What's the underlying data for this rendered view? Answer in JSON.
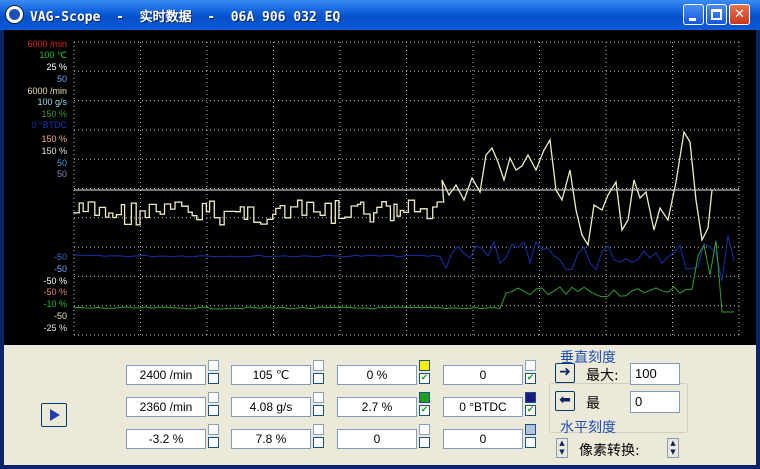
{
  "window": {
    "title": "VAG-Scope  -  实时数据  -  06A 906 032 EQ",
    "btn_minimize": "",
    "btn_maximize": "",
    "btn_close": ""
  },
  "scope": {
    "scale_labels": [
      {
        "text": "6000 /min",
        "color": "#E02020"
      },
      {
        "text": "100 ℃",
        "color": "#20C020"
      },
      {
        "text": "25 %",
        "color": "#FFFFFF"
      },
      {
        "text": "50",
        "color": "#6FA8FF"
      },
      {
        "text": "6000 /min",
        "color": "#E8E0B0"
      },
      {
        "text": "100 g/s",
        "color": "#9ED8E8"
      },
      {
        "text": "150 %",
        "color": "#3A9A3A"
      },
      {
        "text": "0 °BTDC",
        "color": "#1A2FB0"
      },
      {
        "text": "150 %",
        "color": "#F0B090"
      },
      {
        "text": "150 %",
        "color": "#E0E0E0"
      },
      {
        "text": "50",
        "color": "#4AA0E0"
      },
      {
        "text": "50",
        "color": "#8888C0"
      },
      {
        "text": "-50",
        "color": "#2070D0"
      },
      {
        "text": "-50",
        "color": "#6FA8FF"
      },
      {
        "text": "-50 %",
        "color": "#FFFFFF"
      },
      {
        "text": "-50 %",
        "color": "#E08080"
      },
      {
        "text": "-10 %",
        "color": "#20C020"
      },
      {
        "text": "-50",
        "color": "#E8E0B0"
      },
      {
        "text": "-25 %",
        "color": "#E0E0E0"
      }
    ],
    "series": [
      {
        "name": "",
        "color": "#EEEBC0"
      },
      {
        "name": "",
        "color": "#1830A8"
      },
      {
        "name": "",
        "color": "#30A030"
      }
    ]
  },
  "fields": {
    "r1c1": "2400 /min",
    "r1c2": "105 ℃",
    "r1c3": "0 %",
    "r1c4": "0",
    "r2c1": "2360 /min",
    "r2c2": "4.08 g/s",
    "r2c3": "2.7 %",
    "r2c4": "0 °BTDC",
    "r3c1": "-3.2 %",
    "r3c2": "7.8 %",
    "r3c3": "0",
    "r3c4": "0"
  },
  "swatch_colors": {
    "ch3": "#F8F000",
    "ch7": "#20A020",
    "ch11": "#1A1A80",
    "ch12": "#B0C4E0"
  },
  "vertical_scale": {
    "title": "垂直刻度",
    "max_label": "最大:",
    "max_value": "100",
    "min_label": "最",
    "min_value": "0",
    "right_arrow": "➜",
    "left_arrow": "⬅"
  },
  "horizontal_scale": {
    "title": "水平刻度",
    "pixel_label": "像素转换:",
    "spin_up": "▲",
    "spin_down": "▼"
  }
}
